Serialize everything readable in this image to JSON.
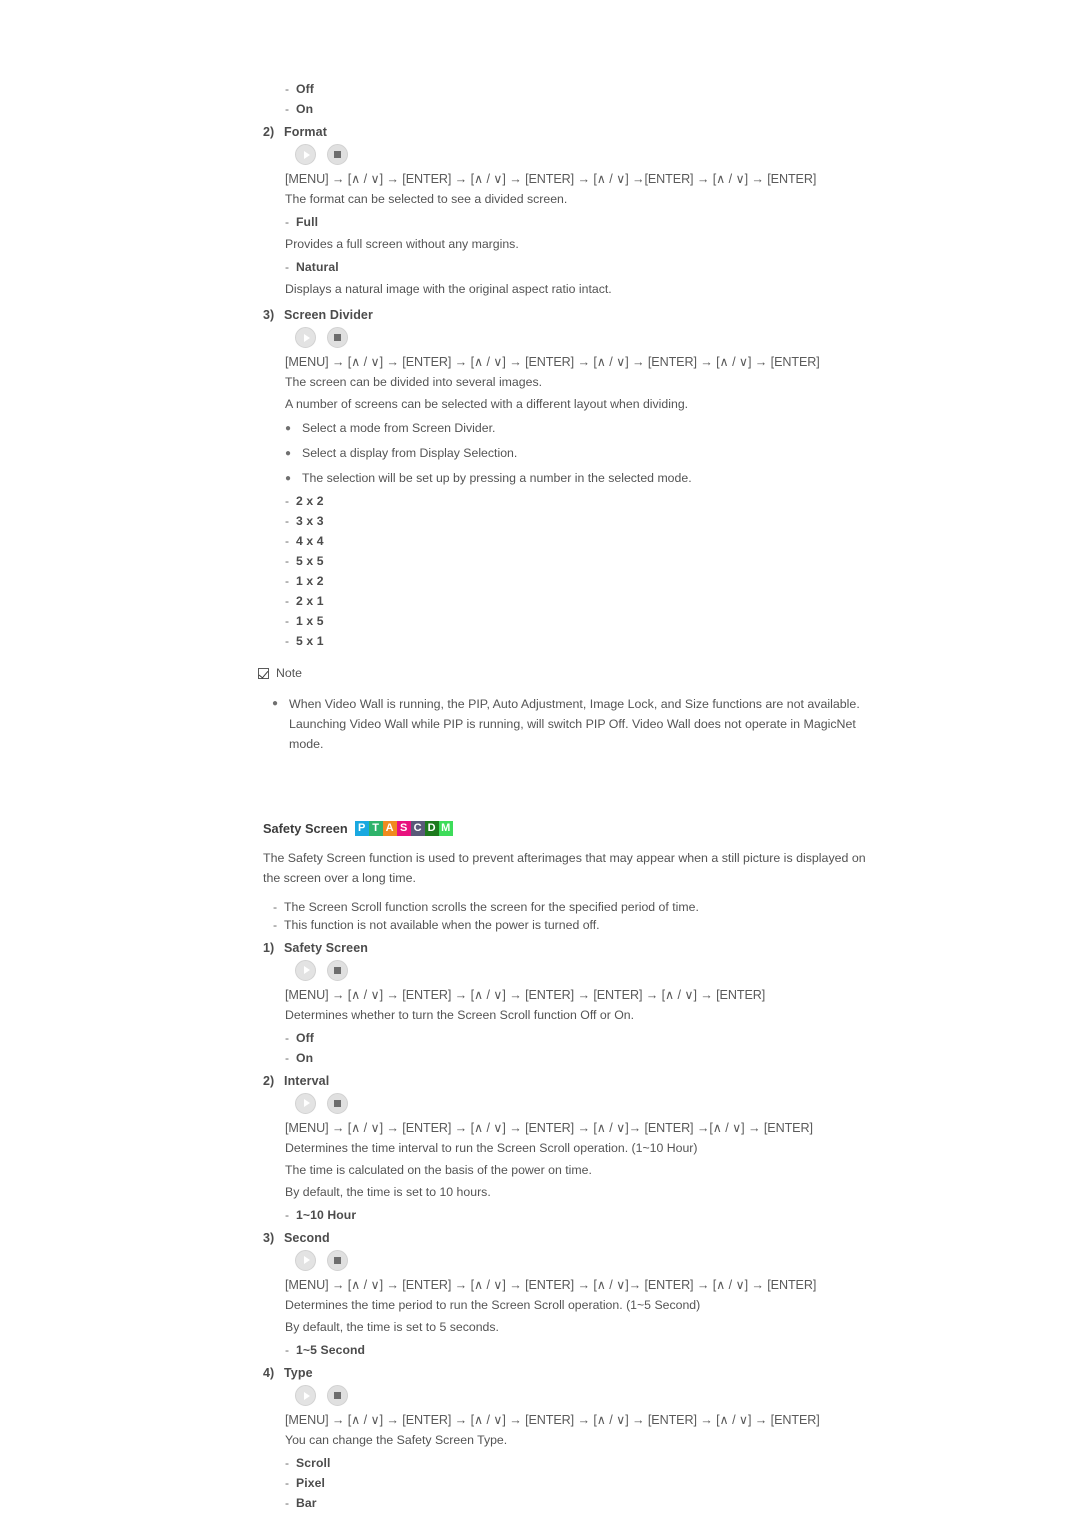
{
  "document": {
    "top_options": [
      {
        "label": "Off"
      },
      {
        "label": "On"
      }
    ],
    "key_path_icons": {
      "play": "play-icon",
      "stop": "stop-icon"
    },
    "sections": [
      {
        "number": "2)",
        "title": "Format",
        "keypath": "[MENU] → [∧ / ∨] → [ENTER] → [∧ / ∨] → [ENTER] → [∧ / ∨] →[ENTER] → [∧ / ∨] → [ENTER]",
        "description": "The format can be selected to see a divided screen.",
        "options": [
          {
            "label": "Full",
            "desc": "Provides a full screen without any margins."
          },
          {
            "label": "Natural",
            "desc": "Displays a natural image with the original aspect ratio intact."
          }
        ]
      },
      {
        "number": "3)",
        "title": "Screen Divider",
        "keypath": "[MENU] → [∧ / ∨] → [ENTER] → [∧ / ∨] → [ENTER] → [∧ / ∨] → [ENTER] → [∧ / ∨] → [ENTER]",
        "lines": [
          "The screen can be divided into several images.",
          "A number of screens can be selected with a different layout when dividing."
        ],
        "bullets": [
          "Select a mode from Screen Divider.",
          "Select a display from Display Selection.",
          "The selection will be set up by pressing a number in the selected mode."
        ],
        "layouts": [
          "2 x 2",
          "3 x 3",
          "4 x 4",
          "5 x 5",
          "1 x 2",
          "2 x 1",
          "1 x 5",
          "5 x 1"
        ]
      }
    ],
    "note": {
      "label": "Note",
      "text": "When Video Wall is running, the PIP, Auto Adjustment, Image Lock, and Size functions are not available. Launching Video Wall while PIP is running, will switch PIP Off. Video Wall does not operate in MagicNet mode."
    },
    "safety_screen": {
      "heading": "Safety Screen",
      "badge": [
        {
          "letter": "P",
          "color": "#19a8e0"
        },
        {
          "letter": "T",
          "color": "#2eb36a"
        },
        {
          "letter": "A",
          "color": "#f08a1e"
        },
        {
          "letter": "S",
          "color": "#e8127e"
        },
        {
          "letter": "C",
          "color": "#5a5a78"
        },
        {
          "letter": "D",
          "color": "#1d7a1d"
        },
        {
          "letter": "M",
          "color": "#3ddc5a"
        }
      ],
      "intro": "The Safety Screen function is used to prevent afterimages that may appear when a still picture is displayed on the screen over a long time.",
      "notes": [
        "The Screen Scroll function scrolls the screen for the specified period of time.",
        "This function is not available when the power is turned off."
      ],
      "sections": [
        {
          "number": "1)",
          "title": "Safety Screen",
          "keypath": "[MENU] → [∧ / ∨] → [ENTER] → [∧ / ∨] → [ENTER] → [ENTER] → [∧ / ∨] → [ENTER]",
          "lines": [
            "Determines whether to turn the Screen Scroll function Off or On."
          ],
          "options": [
            "Off",
            "On"
          ]
        },
        {
          "number": "2)",
          "title": "Interval",
          "keypath": "[MENU] → [∧ / ∨] → [ENTER] → [∧ / ∨] → [ENTER] → [∧ / ∨]→ [ENTER] →[∧ / ∨] → [ENTER]",
          "lines": [
            "Determines the time interval to run the Screen Scroll operation. (1~10 Hour)",
            "The time is calculated on the basis of the power on time.",
            "By default, the time is set to 10 hours."
          ],
          "options": [
            "1~10 Hour"
          ]
        },
        {
          "number": "3)",
          "title": "Second",
          "keypath": "[MENU] → [∧ / ∨] → [ENTER] → [∧ / ∨] → [ENTER] → [∧ / ∨]→ [ENTER] → [∧ / ∨] → [ENTER]",
          "lines": [
            "Determines the time period to run the Screen Scroll operation. (1~5 Second)",
            "By default, the time is set to 5 seconds."
          ],
          "options": [
            "1~5 Second"
          ]
        },
        {
          "number": "4)",
          "title": "Type",
          "keypath": "[MENU] → [∧ / ∨] → [ENTER] → [∧ / ∨] → [ENTER] → [∧ / ∨] → [ENTER] → [∧ / ∨] → [ENTER]",
          "lines": [
            "You can change the Safety Screen Type."
          ],
          "options": [
            "Scroll",
            "Pixel",
            "Bar"
          ]
        }
      ]
    }
  }
}
